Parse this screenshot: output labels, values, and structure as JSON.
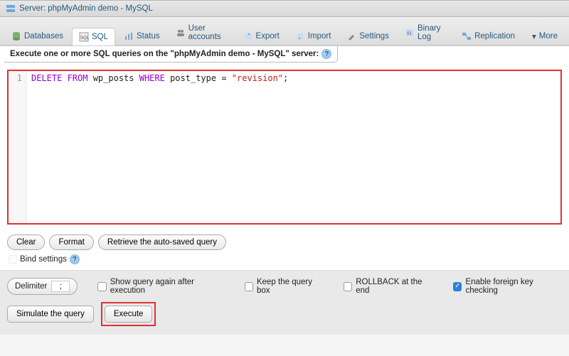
{
  "breadcrumb": "Server: phpMyAdmin demo - MySQL",
  "tabs": [
    {
      "label": "Databases"
    },
    {
      "label": "SQL"
    },
    {
      "label": "Status"
    },
    {
      "label": "User accounts"
    },
    {
      "label": "Export"
    },
    {
      "label": "Import"
    },
    {
      "label": "Settings"
    },
    {
      "label": "Binary Log"
    },
    {
      "label": "Replication"
    },
    {
      "label": "More"
    }
  ],
  "active_tab_index": 1,
  "query_title_prefix": "Execute one or more SQL queries on the \"phpMyAdmin demo - MySQL\" server:",
  "editor": {
    "line_number": "1",
    "tokens": {
      "k1": "DELETE FROM",
      "t1": " wp_posts ",
      "k2": "WHERE",
      "t2": " post_type = ",
      "s1": "\"revision\"",
      "t3": ";"
    }
  },
  "buttons": {
    "clear": "Clear",
    "format": "Format",
    "retrieve": "Retrieve the auto-saved query"
  },
  "bind_settings": "Bind settings",
  "bottom": {
    "delimiter_label": "Delimiter",
    "delimiter_value": ";",
    "show_again": "Show query again after execution",
    "keep_box": "Keep the query box",
    "rollback": "ROLLBACK at the end",
    "fk_check": "Enable foreign key checking",
    "fk_checked": true,
    "simulate": "Simulate the query",
    "execute": "Execute"
  }
}
